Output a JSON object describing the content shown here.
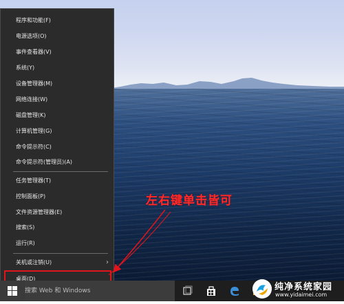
{
  "context_menu": {
    "items": [
      {
        "label": "程序和功能(F)"
      },
      {
        "label": "电源选项(O)"
      },
      {
        "label": "事件查看器(V)"
      },
      {
        "label": "系统(Y)"
      },
      {
        "label": "设备管理器(M)"
      },
      {
        "label": "网络连接(W)"
      },
      {
        "label": "磁盘管理(K)"
      },
      {
        "label": "计算机管理(G)"
      },
      {
        "label": "命令提示符(C)"
      },
      {
        "label": "命令提示符(管理员)(A)"
      },
      {
        "label": "任务管理器(T)"
      },
      {
        "label": "控制面板(P)"
      },
      {
        "label": "文件资源管理器(E)"
      },
      {
        "label": "搜索(S)"
      },
      {
        "label": "运行(R)"
      },
      {
        "label": "关机或注销(U)"
      },
      {
        "label": "桌面(D)"
      }
    ],
    "submenu_arrow": "›",
    "highlight_color": "#e0151b"
  },
  "annotation": {
    "text": "左右键单击皆可",
    "color": "#ff2a2a"
  },
  "taskbar": {
    "start_icon": "windows-logo-icon",
    "search_placeholder": "搜索 Web 和 Windows",
    "icons": [
      "task-view-icon",
      "store-icon",
      "edge-icon",
      "file-explorer-icon"
    ]
  },
  "watermark": {
    "title": "纯净系统家园",
    "url": "www.yidaimei.com"
  }
}
